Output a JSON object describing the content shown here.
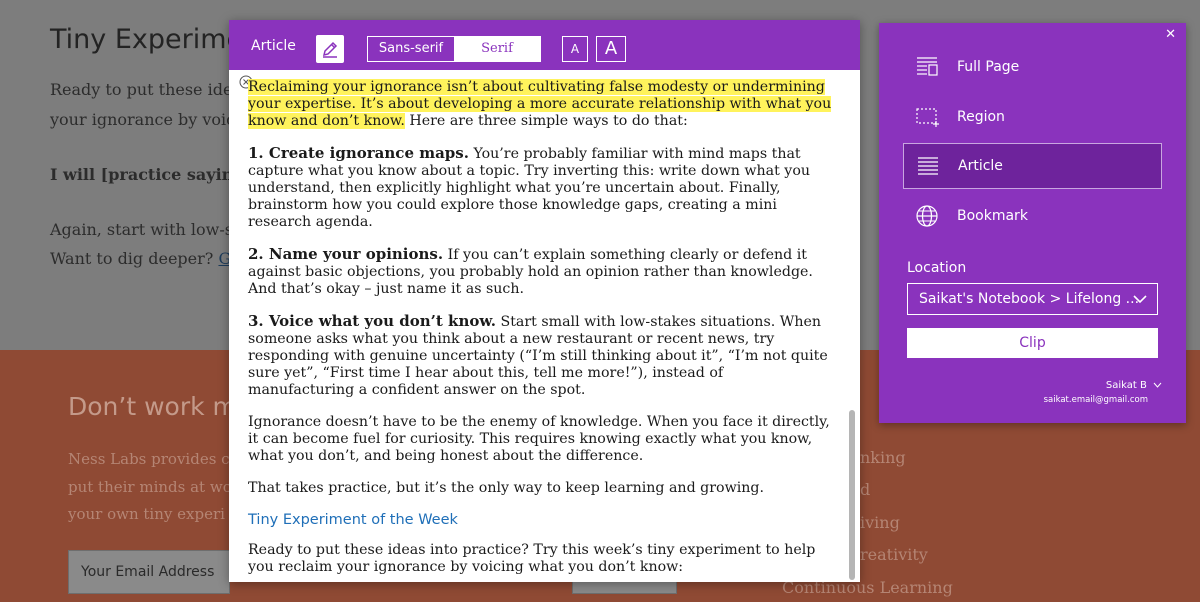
{
  "background": {
    "title": "Tiny Experimen",
    "lines": [
      "Ready to put these ide",
      "your ignorance by voic"
    ],
    "bold_line": "I will [practice saying “",
    "again_lines": [
      "Again, start with low-s",
      "Want to dig deeper?"
    ],
    "dig_link": "G",
    "newsletter_title": "Don’t work m",
    "newsletter_lines": [
      "Ness Labs provides c",
      "put their minds at wo",
      "your own tiny experi"
    ],
    "email_placeholder": "Your Email Address",
    "right_list": [
      "nking",
      "d",
      "iving",
      "reativity",
      "Continuous Learning"
    ]
  },
  "reader": {
    "title": "Article",
    "font_sans_label": "Sans-serif",
    "font_serif_label": "Serif",
    "size_small_label": "A",
    "size_large_label": "A",
    "intro_highlight": "Reclaiming your ignorance isn’t about cultivating false modesty or undermining your expertise. It’s about developing a more accurate relationship with what you know and don’t know.",
    "intro_rest": " Here are three simple ways to do that:",
    "items": [
      {
        "heading": "1. Create ignorance maps.",
        "text": " You’re probably familiar with mind maps that capture what you know about a topic. Try inverting this: write down what you understand, then explicitly highlight what you’re uncertain about. Finally, brainstorm how you could explore those knowledge gaps, creating a mini research agenda."
      },
      {
        "heading": "2. Name your opinions.",
        "text": " If you can’t explain something clearly or defend it against basic objections, you probably hold an opinion rather than knowledge. And that’s okay – just name it as such."
      },
      {
        "heading": "3. Voice what you don’t know.",
        "text": " Start small with low-stakes situations. When someone asks what you think about a new restaurant or recent news, try responding with genuine uncertainty (“I’m still thinking about it”, “I’m not quite sure yet”, “First time I hear about this, tell me more!”), instead of manufacturing a confident answer on the spot."
      }
    ],
    "para_ignorance": "Ignorance doesn’t have to be the enemy of knowledge. When you face it directly, it can become fuel for curiosity. This requires knowing exactly what you know, what you don’t, and being honest about the difference.",
    "para_practice": "That takes practice, but it’s the only way to keep learning and growing.",
    "link_text": "Tiny Experiment of the Week",
    "para_ready": "Ready to put these ideas into practice? Try this week’s tiny experiment to help you reclaim your ignorance by voicing what you don’t know:"
  },
  "clipper": {
    "close_label": "✕",
    "modes": [
      {
        "label": "Full Page",
        "icon": "full-page-icon",
        "active": false
      },
      {
        "label": "Region",
        "icon": "region-icon",
        "active": false
      },
      {
        "label": "Article",
        "icon": "article-icon",
        "active": true
      },
      {
        "label": "Bookmark",
        "icon": "globe-icon",
        "active": false
      }
    ],
    "location_label": "Location",
    "location_value": "Saikat's Notebook > Lifelong ...",
    "clip_label": "Clip",
    "account_name": "Saikat B",
    "account_email": "saikat.email@gmail.com"
  },
  "colors": {
    "accent": "#8a33bd",
    "highlight": "#fff35c",
    "link": "#1f6fb8"
  }
}
